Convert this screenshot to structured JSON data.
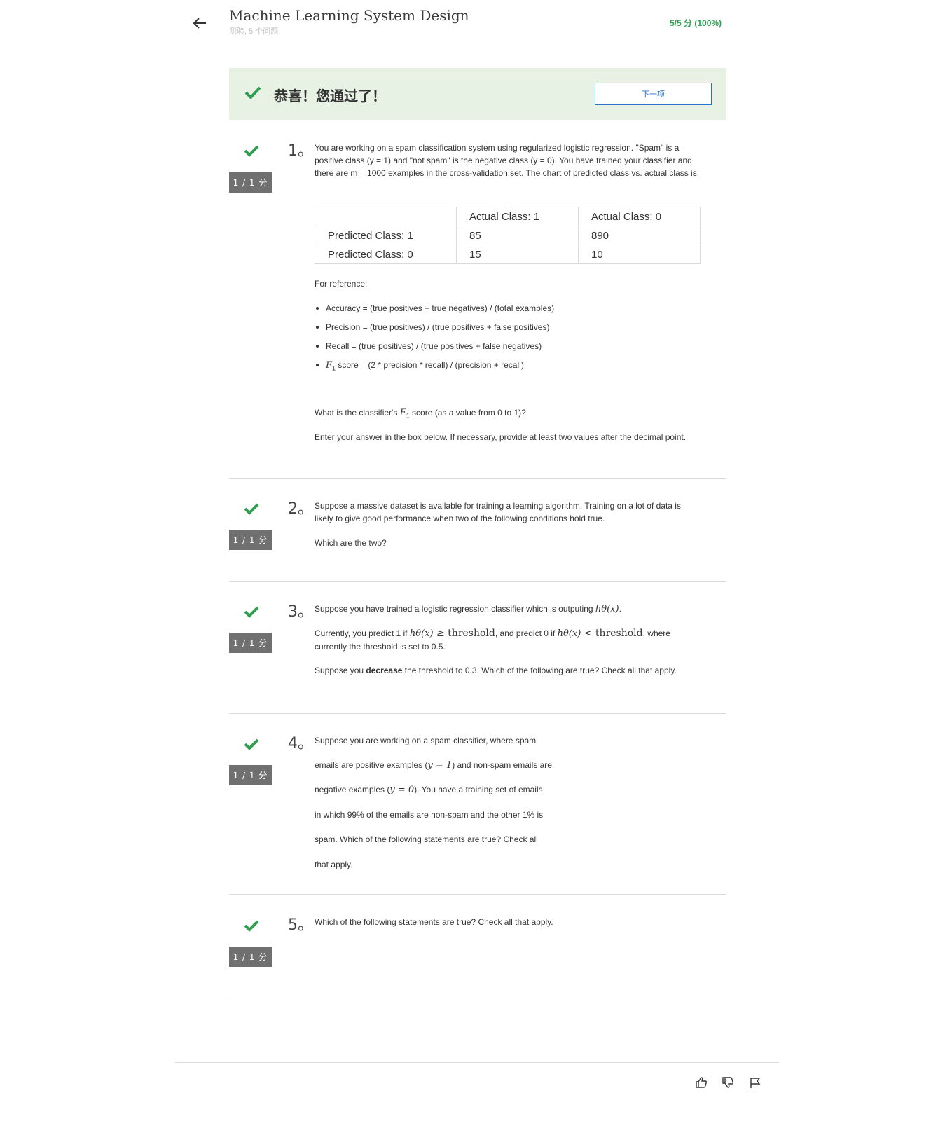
{
  "header": {
    "title": "Machine Learning System Design",
    "subtitle": "测验, 5 个问题",
    "score": "5/5 分 (100%)"
  },
  "banner": {
    "message": "恭喜！您通过了！",
    "next_label": "下一项"
  },
  "colors": {
    "success_green": "#2e9f4f",
    "banner_bg": "#e8f2e4",
    "link_blue": "#2a73cc",
    "badge_gray": "#707070"
  },
  "questions": [
    {
      "number": "1。",
      "score": "1 / 1 分",
      "intro": "You are working on a spam classification system using regularized logistic regression. \"Spam\" is a positive class (y = 1) and \"not spam\" is the negative class (y = 0). You have trained your classifier and there are m = 1000 examples in the cross-validation set. The chart of predicted class vs. actual class is:",
      "table": {
        "headers": [
          "",
          "Actual Class: 1",
          "Actual Class: 0"
        ],
        "rows": [
          [
            "Predicted Class: 1",
            "85",
            "890"
          ],
          [
            "Predicted Class: 0",
            "15",
            "10"
          ]
        ]
      },
      "reference_label": "For reference:",
      "reference_items": [
        "Accuracy = (true positives + true negatives) / (total examples)",
        "Precision = (true positives) / (true positives + false positives)",
        "Recall = (true positives) / (true positives + false negatives)"
      ],
      "f1_symbol": "F",
      "f1_sub": "1",
      "f1_item_rest": " score = (2 * precision * recall) / (precision + recall)",
      "question_pre": "What is the classifier's ",
      "question_post": " score (as a value from 0 to 1)?",
      "instruction": "Enter your answer in the box below. If necessary, provide at least two values after the decimal point."
    },
    {
      "number": "2。",
      "score": "1 / 1 分",
      "text": "Suppose a massive dataset is available for training a learning algorithm. Training on a lot of data is likely to give good performance when two of the following conditions hold true.",
      "sub": "Which are the two?"
    },
    {
      "number": "3。",
      "score": "1 / 1 分",
      "line1_pre": "Suppose you have trained a logistic regression classifier which is outputing ",
      "h_theta_x": "hθ(x)",
      "line1_post": ".",
      "line2_a": "Currently, you predict 1 if ",
      "geq": " ≥ ",
      "threshold_word": "threshold",
      "line2_b": ", and predict 0 if ",
      "lt": " < ",
      "line2_c": ", where currently the threshold is set to 0.5.",
      "line3_a": "Suppose you ",
      "line3_bold": "decrease",
      "line3_b": " the threshold to 0.3. Which of the following are true? Check all that apply."
    },
    {
      "number": "4。",
      "score": "1 / 1 分",
      "lines": [
        "Suppose you are working on a spam classifier, where spam",
        "emails are positive examples (",
        "y = 1",
        ") and non-spam emails are",
        "negative examples (",
        "y = 0",
        "). You have a training set of emails",
        "in which 99% of the emails are non-spam and the other 1% is",
        "spam. Which of the following statements are true? Check all",
        "that apply."
      ]
    },
    {
      "number": "5。",
      "score": "1 / 1 分",
      "text": "Which of the following statements are true? Check all that apply."
    }
  ],
  "footer": {
    "icons": [
      "thumbs-up-icon",
      "thumbs-down-icon",
      "flag-icon"
    ]
  }
}
